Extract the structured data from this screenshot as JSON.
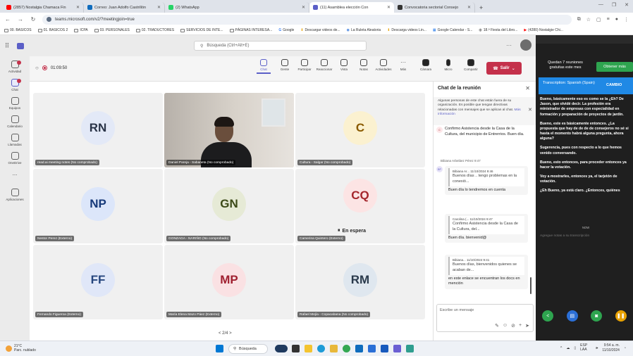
{
  "browser": {
    "tabs": [
      {
        "label": "(2857) Nostalgia Chamaca Fin",
        "color": "#ff0000"
      },
      {
        "label": "Correo: Juan Adolfo Castrillón",
        "color": "#0f6cbd"
      },
      {
        "label": "(2) WhatsApp",
        "color": "#25d366"
      },
      {
        "label": "(11) Asamblea elección Con",
        "color": "#5b5fc7"
      },
      {
        "label": "Convocatoria sectorial Consejo",
        "color": "#333333"
      }
    ],
    "url": "teams.microsoft.com/v2/?meetingjoin=true",
    "bookmarks": [
      "00. BASICOS",
      "01. BASICOS 2",
      "ICPA",
      "03. PERSONALES",
      "02. TRADUCTORES",
      "SERVICIOS DE INTE...",
      "PÁGINAS INTERESA...",
      "Google",
      "Descargar videos de...",
      "La Ruleta Aleatoria",
      "Descarga videos Lin...",
      "Google Calendar - S...",
      "18.ª Fiesta del Libro...",
      "(4280) Nostalgie Chi..."
    ]
  },
  "teams": {
    "search_placeholder": "Búsqueda (Ctrl+Alt+E)",
    "rail": [
      "Actividad",
      "Chat",
      "Equipos",
      "Calendario",
      "Llamadas",
      "OneDrive",
      "...",
      "Aplicaciones"
    ],
    "meeting_timer": "01:09:50",
    "controls": [
      "Chat",
      "Gente",
      "Participar",
      "Reaccionar",
      "Vista",
      "Notas",
      "Actividades",
      "Más",
      "Cámara",
      "Micro",
      "Compartir"
    ],
    "leave_label": "Salir",
    "tiles": [
      {
        "initials": "RN",
        "name": "read.ai meeting notes (No comprobado)",
        "bg": "#e3e9f7",
        "fg": "#2a3447"
      },
      {
        "initials": "",
        "name": "Daniel Pareja - Sabaneta (No comprobado)",
        "bg": "",
        "fg": ""
      },
      {
        "initials": "C",
        "name": "Cultura - Salgar (No comprobado)",
        "bg": "#fbf1d0",
        "fg": "#8a5a00"
      },
      {
        "initials": "NP",
        "name": "Nestor Perez (Externo)",
        "bg": "#dce6fa",
        "fg": "#173a7a"
      },
      {
        "initials": "GN",
        "name": "GONZAGA - NARIÑO (No comprobado)",
        "bg": "#e6ead6",
        "fg": "#3c4a18"
      },
      {
        "initials": "CQ",
        "name": "Camerina Quintero (Externo)",
        "bg": "#fce4e4",
        "fg": "#a4262c"
      },
      {
        "initials": "FF",
        "name": "Fernando Figueroa (Externo)",
        "bg": "#e0e7f8",
        "fg": "#26467e"
      },
      {
        "initials": "MP",
        "name": "María Elena Mazo Páez (Externo)",
        "bg": "#fae1e3",
        "fg": "#a02030"
      },
      {
        "initials": "RM",
        "name": "Rafael Mejía - Copacabana (No comprobado)",
        "bg": "#dfe7ef",
        "fg": "#2a3a4c"
      }
    ],
    "waiting_label": "En espera",
    "pager": "< 2/4 >"
  },
  "chat": {
    "title": "Chat de la reunión",
    "notice": "Algunas personas de este chat están fuera de su organización. Es posible que tengan directivas relacionadas con mensajes que se aplican al chat.",
    "notice_link": "Más información",
    "m1": "Confirmo Asistencia desde la Casa de la Cultura, del municipio de Entrerrios. Buen día.",
    "sender": "Bibiana Arbeláez Pérez 9:47",
    "q1_head": "Bibiana Ar... 11/10/2024 9:46",
    "q1_body": "Buenos días .. tengo problemas en la conexió...",
    "m2": "Buen día lo tendremos en cuenta",
    "q2_head": "Carolina (... 11/10/2024 9:47",
    "q2_body": "Confirmo Asistencia desde la Casa de la Cultura, del...",
    "m3": "Buen día. bienvenid@",
    "q3_head": "Bibiana... 11/10/2024 9:41",
    "q3_body": "Buenos días, bienvenidos quienes se acaban de...",
    "m4": "en este enlace se encuentran los docs en mención",
    "compose_placeholder": "Escribe un mensaje"
  },
  "side": {
    "quota": "Quedan 7 reuniones gratuitas este mes",
    "get_btn": "Obtener más",
    "trans_lang": "Transcription: Spanish (Spain)",
    "trans_change": "CAMBIO",
    "lines": [
      "Bueno, básicamente eso es como se la ¿Eh? De Jason, que olvidé decir. La profesión era ministrador de empresas con especialidad en formación y preparación de proyectos de jardín.",
      "Bueno, este es básicamente entonces. ¿La propuesta que hay de de de de consejeros no sé si hasta el momento habrá alguna pregunta, ahora alguna?",
      "Sugerencia, pues con respecto a lo que hemos venido conversando.",
      "Bueno, esto entonces, para proceder entonces ya hacer la votación.",
      "Voy a mostrarles, entonces ya, el tarjetón de votación.",
      "¿Eh Bueno, ya está claro. ¿Entonces, quiénes"
    ],
    "now_label": "NOW",
    "notes_label": "Agregue notas a su transcripción"
  },
  "taskbar": {
    "temp": "21°C",
    "weather": "Parc. nublado",
    "search": "Búsqueda",
    "lang": "ESP LAA",
    "time": "9:54 a. m.",
    "date": "11/10/2024"
  }
}
